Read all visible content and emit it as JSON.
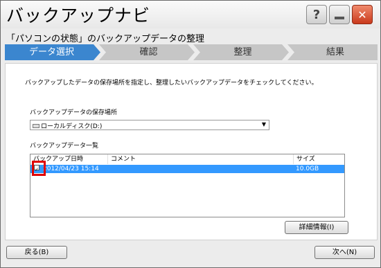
{
  "window": {
    "title": "バックアップナビ",
    "subtitle": "「パソコンの状態」のバックアップデータの整理",
    "help_label": "?",
    "close_label": "✕"
  },
  "steps": [
    {
      "label": "データ選択",
      "active": true
    },
    {
      "label": "確認",
      "active": false
    },
    {
      "label": "整理",
      "active": false
    },
    {
      "label": "結果",
      "active": false
    }
  ],
  "colors": {
    "accent": "#3b86cf",
    "selection": "#3399ff",
    "highlight_box": "#e00000"
  },
  "content": {
    "instruction": "バックアップしたデータの保存場所を指定し、整理したいバックアップデータをチェックしてください。",
    "location": {
      "label": "バックアップデータの保存場所",
      "selected": "ローカルディスク(D:)",
      "icon": "drive-icon"
    },
    "list": {
      "label": "バックアップデータ一覧",
      "columns": [
        "バックアップ日時",
        "コメント",
        "サイズ"
      ],
      "rows": [
        {
          "checked": true,
          "date": "2012/04/23 15:14",
          "comment": "",
          "size": "10.0GB",
          "selected": true
        }
      ]
    },
    "details_button": "詳細情報(I)"
  },
  "footer": {
    "back_button": "戻る(B)",
    "next_button": "次へ(N)"
  }
}
